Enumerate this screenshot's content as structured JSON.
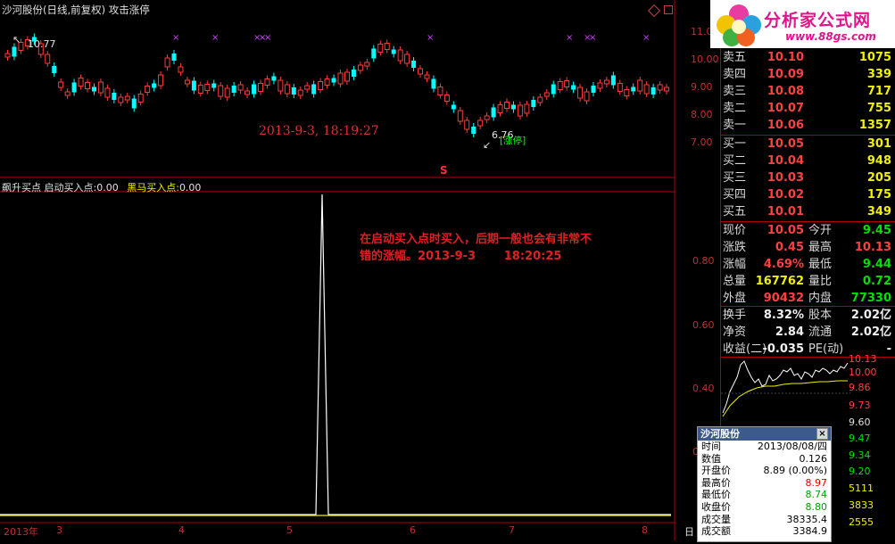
{
  "window_title": "沙河股份(日线,前复权) 攻击涨停",
  "logo": {
    "text": "分析家公式网",
    "url": "www.88gs.com"
  },
  "price_axis_labels": [
    "11.00",
    "10.00",
    "9.00",
    "8.00",
    "7.00"
  ],
  "price_callouts": {
    "high": "10.77",
    "low": "6.76"
  },
  "limit_up_label": "[涨停]",
  "s_marker": "S",
  "date_annotation_top": "2013-9-3, 18:19:27",
  "indicator_title": {
    "name": "飙升买点",
    "start_label": "启动买入点:",
    "start_value": "0.00",
    "black_horse_label": "黑马买入点:",
    "black_horse_value": "0.00"
  },
  "indicator_axis_labels": [
    "0.80",
    "0.60",
    "0.40",
    "0.20"
  ],
  "annotation_lower": {
    "line1": "在启动买入点时买入，后期一般也会有非常不",
    "line2": "错的涨幅。2013-9-3       18:20:25"
  },
  "x_axis": {
    "year_label": "2013年",
    "months": [
      "3",
      "4",
      "5",
      "6",
      "7",
      "8"
    ],
    "right_label": "日"
  },
  "order_book": {
    "asks": [
      {
        "label": "卖五",
        "price": "10.10",
        "volume": "1075"
      },
      {
        "label": "卖四",
        "price": "10.09",
        "volume": "339"
      },
      {
        "label": "卖三",
        "price": "10.08",
        "volume": "717"
      },
      {
        "label": "卖二",
        "price": "10.07",
        "volume": "755"
      },
      {
        "label": "卖一",
        "price": "10.06",
        "volume": "1357"
      }
    ],
    "bids": [
      {
        "label": "买一",
        "price": "10.05",
        "volume": "301"
      },
      {
        "label": "买二",
        "price": "10.04",
        "volume": "948"
      },
      {
        "label": "买三",
        "price": "10.03",
        "volume": "205"
      },
      {
        "label": "买四",
        "price": "10.02",
        "volume": "175"
      },
      {
        "label": "买五",
        "price": "10.01",
        "volume": "349"
      }
    ]
  },
  "quote": {
    "rows": [
      {
        "l1": "现价",
        "v1": "10.05",
        "c1": "red",
        "l2": "今开",
        "v2": "9.45",
        "c2": "green"
      },
      {
        "l1": "涨跌",
        "v1": "0.45",
        "c1": "red",
        "l2": "最高",
        "v2": "10.13",
        "c2": "red"
      },
      {
        "l1": "涨幅",
        "v1": "4.69%",
        "c1": "red",
        "l2": "最低",
        "v2": "9.44",
        "c2": "green"
      },
      {
        "l1": "总量",
        "v1": "167762",
        "c1": "yellow",
        "l2": "量比",
        "v2": "0.72",
        "c2": "green"
      },
      {
        "l1": "外盘",
        "v1": "90432",
        "c1": "red",
        "l2": "内盘",
        "v2": "77330",
        "c2": "green"
      }
    ],
    "rows2": [
      {
        "l1": "换手",
        "v1": "8.32%",
        "l2": "股本",
        "v2": "2.02亿"
      },
      {
        "l1": "净资",
        "v1": "2.84",
        "l2": "流通",
        "v2": "2.02亿"
      },
      {
        "l1": "收益(二)",
        "v1": "-0.035",
        "l2": "PE(动)",
        "v2": "-"
      }
    ]
  },
  "mini_chart_labels": {
    "right": [
      "10.13",
      "10.00",
      "9.86",
      "9.73",
      "9.60",
      "9.47",
      "9.34",
      "9.20",
      "5111",
      "3833",
      "2555"
    ]
  },
  "popup": {
    "title": "沙河股份",
    "rows": [
      {
        "key": "时间",
        "value": "2013/08/08/四",
        "color": "#000000"
      },
      {
        "key": "数值",
        "value": "0.126",
        "color": "#000000"
      },
      {
        "key": "开盘价",
        "value": "8.89 (0.00%)",
        "color": "#000000"
      },
      {
        "key": "最高价",
        "value": "8.97",
        "color": "#e00000"
      },
      {
        "key": "最低价",
        "value": "8.74",
        "color": "#00a000"
      },
      {
        "key": "收盘价",
        "value": "8.80",
        "color": "#00a000"
      },
      {
        "key": "成交量",
        "value": "38335.4",
        "color": "#000000"
      },
      {
        "key": "成交额",
        "value": "3384.9",
        "color": "#000000"
      }
    ]
  },
  "colors": {
    "up": "#ff3b3b",
    "down": "#00ffff",
    "axis": "#b00000",
    "signal_line": "#ffffff",
    "baseline": "#f0f000"
  }
}
